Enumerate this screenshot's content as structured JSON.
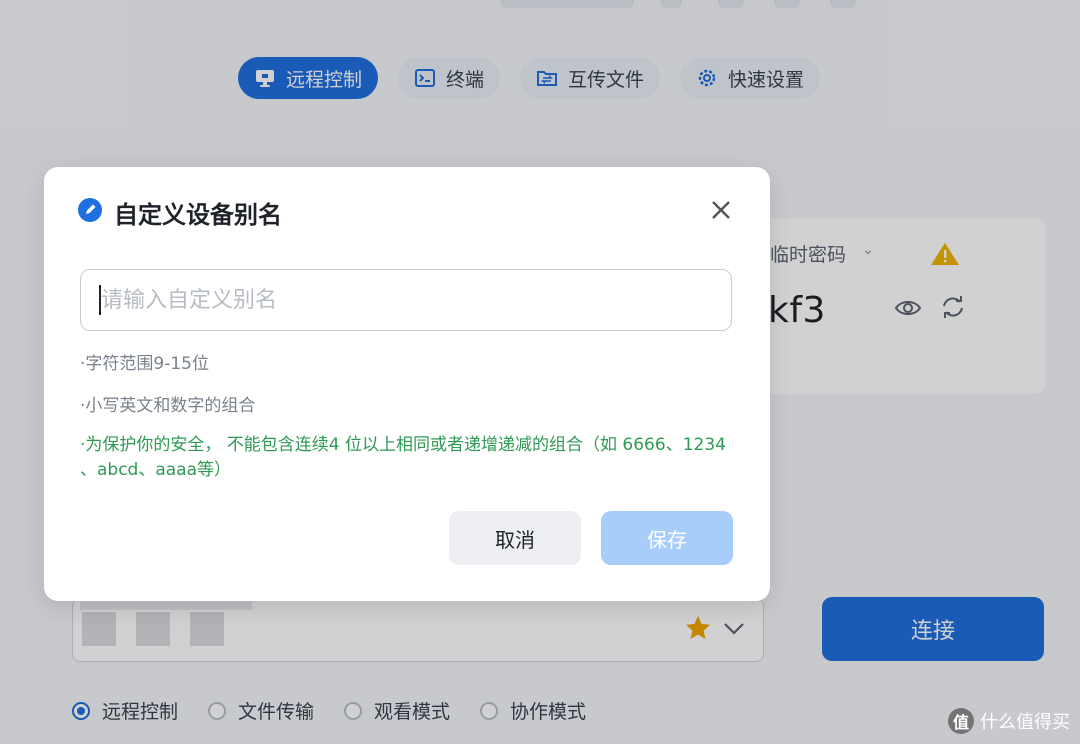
{
  "tabs": [
    {
      "label": "远程控制",
      "icon": "monitor-icon",
      "active": true
    },
    {
      "label": "终端",
      "icon": "terminal-icon",
      "active": false
    },
    {
      "label": "互传文件",
      "icon": "transfer-icon",
      "active": false
    },
    {
      "label": "快速设置",
      "icon": "gear-icon",
      "active": false
    }
  ],
  "password_panel": {
    "label": "临时密码",
    "value": "kf3"
  },
  "connect_label": "连接",
  "modes": [
    {
      "label": "远程控制",
      "selected": true
    },
    {
      "label": "文件传输",
      "selected": false
    },
    {
      "label": "观看模式",
      "selected": false
    },
    {
      "label": "协作模式",
      "selected": false
    }
  ],
  "dialog": {
    "title": "自定义设备别名",
    "input_placeholder": "请输入自定义别名",
    "input_value": "",
    "rules": [
      "·字符范围9-15位",
      "·小写英文和数字的组合",
      "·为保护你的安全， 不能包含连续4 位以上相同或者递增递减的组合（如 6666、1234 、abcd、aaaa等）"
    ],
    "cancel_label": "取消",
    "save_label": "保存"
  },
  "watermark": "什么值得买",
  "colors": {
    "accent": "#1f6fe0",
    "save_disabled": "#a9cdfa",
    "rule_green": "#2f9a55"
  }
}
